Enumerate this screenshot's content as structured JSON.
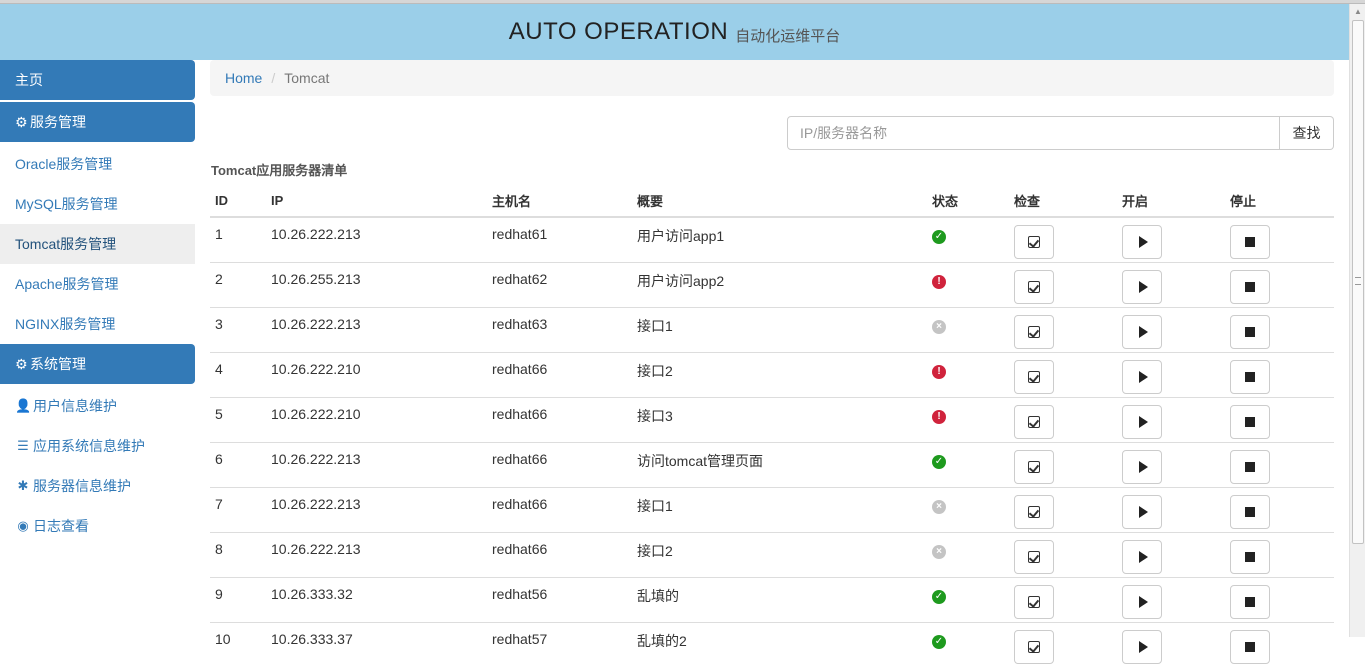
{
  "header": {
    "title": "AUTO OPERATION",
    "subtitle": "自动化运维平台"
  },
  "sidebar": {
    "home": "主页",
    "service_mgmt": "服务管理",
    "services": [
      "Oracle服务管理",
      "MySQL服务管理",
      "Tomcat服务管理",
      "Apache服务管理",
      "NGINX服务管理"
    ],
    "system_mgmt": "系统管理",
    "system_items": [
      {
        "label": "用户信息维护",
        "icon": "user-icon"
      },
      {
        "label": "应用系统信息维护",
        "icon": "list-icon"
      },
      {
        "label": "服务器信息维护",
        "icon": "asterisk-icon"
      },
      {
        "label": "日志查看",
        "icon": "eye-icon"
      }
    ]
  },
  "breadcrumb": {
    "home": "Home",
    "current": "Tomcat"
  },
  "search": {
    "placeholder": "IP/服务器名称",
    "button": "查找"
  },
  "list_title": "Tomcat应用服务器清单",
  "table": {
    "headers": [
      "ID",
      "IP",
      "主机名",
      "概要",
      "状态",
      "检查",
      "开启",
      "停止"
    ],
    "rows": [
      {
        "id": "1",
        "ip": "10.26.222.213",
        "host": "redhat61",
        "summary": "用户访问app1",
        "status": "ok"
      },
      {
        "id": "2",
        "ip": "10.26.255.213",
        "host": "redhat62",
        "summary": "用户访问app2",
        "status": "error"
      },
      {
        "id": "3",
        "ip": "10.26.222.213",
        "host": "redhat63",
        "summary": "接口1",
        "status": "off"
      },
      {
        "id": "4",
        "ip": "10.26.222.210",
        "host": "redhat66",
        "summary": "接口2",
        "status": "error"
      },
      {
        "id": "5",
        "ip": "10.26.222.210",
        "host": "redhat66",
        "summary": "接口3",
        "status": "error"
      },
      {
        "id": "6",
        "ip": "10.26.222.213",
        "host": "redhat66",
        "summary": "访问tomcat管理页面",
        "status": "ok"
      },
      {
        "id": "7",
        "ip": "10.26.222.213",
        "host": "redhat66",
        "summary": "接口1",
        "status": "off"
      },
      {
        "id": "8",
        "ip": "10.26.222.213",
        "host": "redhat66",
        "summary": "接口2",
        "status": "off"
      },
      {
        "id": "9",
        "ip": "10.26.333.32",
        "host": "redhat56",
        "summary": "乱填的",
        "status": "ok"
      },
      {
        "id": "10",
        "ip": "10.26.333.37",
        "host": "redhat57",
        "summary": "乱填的2",
        "status": "ok"
      }
    ]
  },
  "colors": {
    "header_bg": "#9bcfe9",
    "primary": "#337ab7",
    "ok": "#1e9a1e",
    "error": "#d0233c",
    "off": "#c4c4c4"
  }
}
